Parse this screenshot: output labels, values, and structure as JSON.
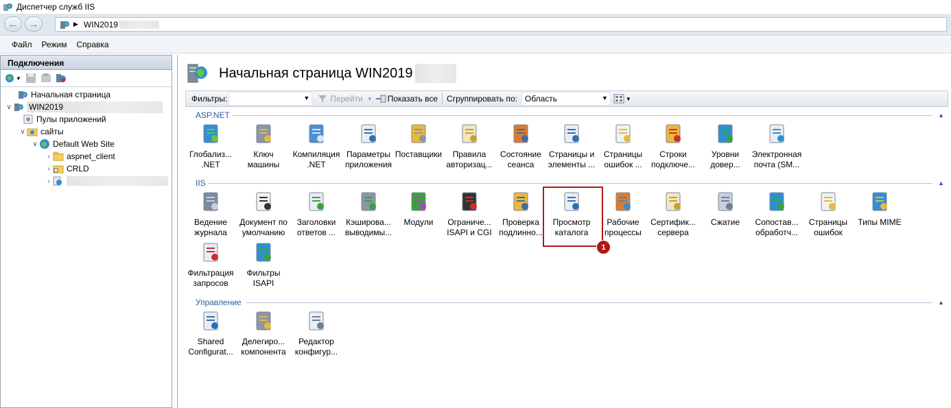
{
  "window": {
    "title": "Диспетчер служб IIS"
  },
  "address": {
    "segment": "WIN2019"
  },
  "menu": {
    "items": [
      "Файл",
      "Режим",
      "Справка"
    ]
  },
  "left": {
    "header": "Подключения",
    "tree": [
      {
        "label": "Начальная страница"
      },
      {
        "label": "WIN2019"
      },
      {
        "label": "Пулы приложений"
      },
      {
        "label": "сайты"
      },
      {
        "label": "Default Web Site"
      },
      {
        "label": "aspnet_client"
      },
      {
        "label": "CRLD"
      }
    ]
  },
  "page": {
    "title": "Начальная страница WIN2019"
  },
  "filter": {
    "label": "Фильтры:",
    "go": "Перейти",
    "show_all": "Показать все",
    "group_label": "Сгруппировать по:",
    "group_value": "Область"
  },
  "sections": {
    "aspnet": {
      "title": "ASP.NET",
      "items": [
        {
          "label": "Глобализ...\n.NET",
          "icon": "globe-icon"
        },
        {
          "label": "Ключ\nмашины",
          "icon": "key-icon"
        },
        {
          "label": "Компиляция\n.NET",
          "icon": "compile-icon"
        },
        {
          "label": "Параметры\nприложения",
          "icon": "settings-list-icon"
        },
        {
          "label": "Поставщики",
          "icon": "providers-icon"
        },
        {
          "label": "Правила\nавторизац...",
          "icon": "authorization-icon"
        },
        {
          "label": "Состояние\nсеанса",
          "icon": "session-icon"
        },
        {
          "label": "Страницы и\nэлементы ...",
          "icon": "pages-icon"
        },
        {
          "label": "Страницы\nошибок ...",
          "icon": "error-page-icon"
        },
        {
          "label": "Строки\nподключе...",
          "icon": "connection-string-icon"
        },
        {
          "label": "Уровни\nдовер...",
          "icon": "trust-level-icon"
        },
        {
          "label": "Электронная\nпочта (SM...",
          "icon": "email-icon"
        }
      ]
    },
    "iis": {
      "title": "IIS",
      "items": [
        {
          "label": "Ведение\nжурнала",
          "icon": "log-icon"
        },
        {
          "label": "Документ по\nумолчанию",
          "icon": "default-document-icon"
        },
        {
          "label": "Заголовки\nответов ...",
          "icon": "headers-icon"
        },
        {
          "label": "Кэширова...\nвыводимы...",
          "icon": "cache-icon"
        },
        {
          "label": "Модули",
          "icon": "modules-icon"
        },
        {
          "label": "Ограниче...\nISAPI и CGI",
          "icon": "isapi-cgi-icon"
        },
        {
          "label": "Проверка\nподлинно...",
          "icon": "authentication-icon"
        },
        {
          "label": "Просмотр\nкаталога",
          "icon": "directory-browsing-icon"
        },
        {
          "label": "Рабочие\nпроцессы",
          "icon": "worker-process-icon"
        },
        {
          "label": "Сертифик...\nсервера",
          "icon": "certificate-icon"
        },
        {
          "label": "Сжатие",
          "icon": "compression-icon"
        },
        {
          "label": "Сопостав...\nобработч...",
          "icon": "handler-mapping-icon"
        },
        {
          "label": "Страницы\nошибок",
          "icon": "error-page-icon"
        },
        {
          "label": "Типы MIME",
          "icon": "mime-icon"
        },
        {
          "label": "Фильтрация\nзапросов",
          "icon": "request-filtering-icon"
        },
        {
          "label": "Фильтры\nISAPI",
          "icon": "isapi-filter-icon"
        }
      ]
    },
    "management": {
      "title": "Управление",
      "items": [
        {
          "label": "Shared\nConfigurat...",
          "icon": "shared-config-icon"
        },
        {
          "label": "Делегиро...\nкомпонента",
          "icon": "delegation-icon"
        },
        {
          "label": "Редактор\nконфигур...",
          "icon": "config-editor-icon"
        }
      ]
    }
  },
  "annotation": {
    "badge": "1"
  }
}
